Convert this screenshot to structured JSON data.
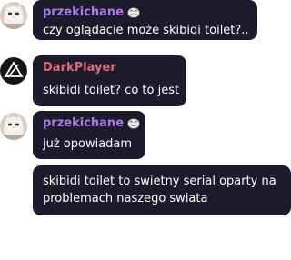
{
  "messages": [
    {
      "username": "przekichane",
      "username_color": "#a77ee3",
      "badge_icon": "trollface-emote-icon",
      "text": "czy oglądacie może skibidi toilet?.."
    },
    {
      "username": "DarkPlayer",
      "username_color": "#e06b75",
      "avatar_icon": "triangle-logo-icon",
      "text": "skibidi toilet? co to jest"
    },
    {
      "username": "przekichane",
      "username_color": "#a77ee3",
      "badge_icon": "trollface-emote-icon",
      "text": "już opowiadam"
    },
    {
      "text": "skibidi toilet to swietny serial oparty na problemach naszego swiata"
    }
  ],
  "colors": {
    "bubble_bg": "#1d1a2c",
    "message_text": "#ffffff",
    "page_bg": "#ffffff"
  }
}
